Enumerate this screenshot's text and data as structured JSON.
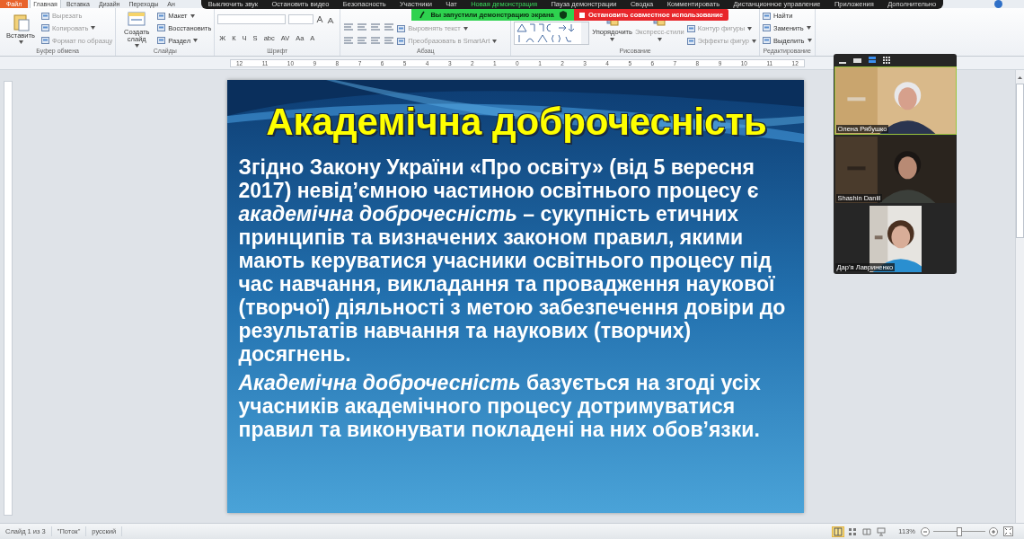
{
  "ribbon": {
    "tabs": [
      {
        "label": "Файл",
        "kind": "file",
        "selected": false
      },
      {
        "label": "Главная",
        "kind": "tab",
        "selected": true
      },
      {
        "label": "Вставка",
        "kind": "tab",
        "selected": false
      },
      {
        "label": "Дизайн",
        "kind": "tab",
        "selected": false
      },
      {
        "label": "Переходы",
        "kind": "tab",
        "selected": false
      },
      {
        "label": "Ан",
        "kind": "tab",
        "selected": false
      }
    ],
    "groups": [
      {
        "label": "Буфер обмена",
        "columns": [
          [
            {
              "kind": "large",
              "label": "Вставить",
              "disabled": false,
              "has_menu": true
            }
          ],
          [
            {
              "kind": "small",
              "label": "Вырезать",
              "disabled": true,
              "has_menu": false
            },
            {
              "kind": "small",
              "label": "Копировать",
              "disabled": true,
              "has_menu": true
            },
            {
              "kind": "small",
              "label": "Формат по образцу",
              "disabled": true,
              "has_menu": false
            }
          ]
        ]
      },
      {
        "label": "Слайды",
        "columns": [
          [
            {
              "kind": "large",
              "label": "Создать слайд",
              "disabled": false,
              "has_menu": true
            }
          ],
          [
            {
              "kind": "small",
              "label": "Макет",
              "disabled": false,
              "has_menu": true
            },
            {
              "kind": "small",
              "label": "Восстановить",
              "disabled": false,
              "has_menu": false
            },
            {
              "kind": "small",
              "label": "Раздел",
              "disabled": false,
              "has_menu": true
            }
          ]
        ]
      },
      {
        "label": "Шрифт",
        "columns": [
          [
            {
              "kind": "field_row"
            },
            {
              "kind": "format_row",
              "glyphs": [
                "Ж",
                "К",
                "Ч",
                "S",
                "abc",
                "AV",
                "Aa",
                "A"
              ]
            }
          ]
        ]
      },
      {
        "label": "Абзац",
        "columns": [
          [
            {
              "kind": "icon_row"
            },
            {
              "kind": "icon_row"
            }
          ],
          [
            {
              "kind": "small",
              "label": "Выровнять текст",
              "disabled": true,
              "has_menu": true
            },
            {
              "kind": "small",
              "label": "Преобразовать в SmartArt",
              "disabled": true,
              "has_menu": true
            }
          ]
        ]
      },
      {
        "label": "Рисование",
        "columns": [
          [
            {
              "kind": "shapes_gallery"
            }
          ],
          [
            {
              "kind": "tall",
              "label": "Упорядочить",
              "disabled": false,
              "has_menu": true
            }
          ],
          [
            {
              "kind": "tall",
              "label": "Экспресс-стили",
              "disabled": true,
              "has_menu": true
            }
          ],
          [
            {
              "kind": "small",
              "label": "Контур фигуры",
              "disabled": true,
              "has_menu": true
            },
            {
              "kind": "small",
              "label": "Эффекты фигур",
              "disabled": true,
              "has_menu": true
            }
          ]
        ]
      },
      {
        "label": "Редактирование",
        "columns": [
          [
            {
              "kind": "small",
              "label": "Найти",
              "disabled": false,
              "has_menu": false
            },
            {
              "kind": "small",
              "label": "Заменить",
              "disabled": false,
              "has_menu": true
            },
            {
              "kind": "small",
              "label": "Выделить",
              "disabled": false,
              "has_menu": true
            }
          ]
        ]
      }
    ]
  },
  "meeting_toolbar": {
    "items": [
      {
        "label": "Выключить звук",
        "highlighted": false
      },
      {
        "label": "Остановить видео",
        "highlighted": false
      },
      {
        "label": "Безопасность",
        "highlighted": false
      },
      {
        "label": "Участники",
        "highlighted": false
      },
      {
        "label": "Чат",
        "highlighted": false
      },
      {
        "label": "Новая демонстрация",
        "highlighted": true
      },
      {
        "label": "Пауза демонстрации",
        "highlighted": false
      },
      {
        "label": "Сводка",
        "highlighted": false
      },
      {
        "label": "Комментировать",
        "highlighted": false
      },
      {
        "label": "Дистанционное управление",
        "highlighted": false
      },
      {
        "label": "Приложения",
        "highlighted": false
      },
      {
        "label": "Дополнительно",
        "highlighted": false
      }
    ]
  },
  "share_banner": {
    "text": "Вы запустили демонстрацию экрана",
    "stop_button": "Остановить совместное использование"
  },
  "ruler": {
    "labels": [
      "12",
      "11",
      "10",
      "9",
      "8",
      "7",
      "6",
      "5",
      "4",
      "3",
      "2",
      "1",
      "0",
      "1",
      "2",
      "3",
      "4",
      "5",
      "6",
      "7",
      "8",
      "9",
      "10",
      "11",
      "12"
    ]
  },
  "slide": {
    "title": "Академічна доброчесність",
    "paragraphs": [
      "Згідно Закону України «Про освіту» (від 5 вересня 2017) невід’ємною частиною освітнього процесу є *академічна доброчесність* – сукупність етичних принципів та визначених законом правил, якими мають керуватися учасники освітнього процесу під час навчання, викладання та провадження наукової (творчої) діяльності з метою забезпечення довіри до результатів навчання та наукових (творчих) досягнень.",
      "*Академічна доброчесність* базується на згоді усіх учасників академічного процесу дотримуватися правил та виконувати покладені на них обов’язки."
    ]
  },
  "video_panel": {
    "participants": [
      {
        "name": "Олена Рябушко",
        "active": true
      },
      {
        "name": "Shashin Daniil",
        "active": false
      },
      {
        "name": "Дар’я Лавриненко",
        "active": false
      }
    ]
  },
  "status_bar": {
    "items": [
      "Слайд 1 из 3",
      "\"Поток\"",
      "русский"
    ],
    "views": [
      {
        "selected": true
      },
      {
        "selected": false
      },
      {
        "selected": false
      },
      {
        "selected": false
      }
    ],
    "zoom": "113%",
    "zoom_slider": {
      "level": 0.5
    }
  }
}
